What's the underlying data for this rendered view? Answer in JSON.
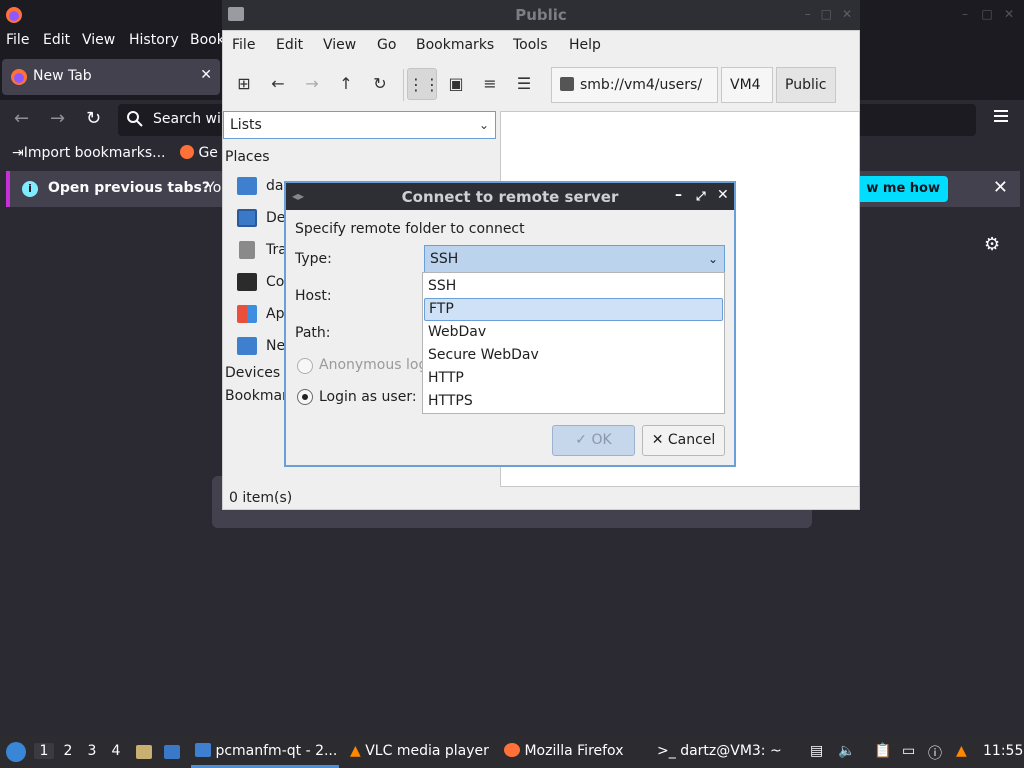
{
  "firefox": {
    "menu": [
      "File",
      "Edit",
      "View",
      "History",
      "Book"
    ],
    "tab_label": "New Tab",
    "search_placeholder": "Search wi",
    "bookmarks": {
      "import": "Import bookmarks...",
      "getting": "Ge"
    },
    "notification": {
      "title": "Open previous tabs?",
      "body": "You",
      "action": "w me how"
    },
    "colors": {
      "accent": "#00ddff",
      "notif_bar": "#c72fd9"
    }
  },
  "filemanager": {
    "title": "Public",
    "menu": [
      "File",
      "Edit",
      "View",
      "Go",
      "Bookmarks",
      "Tools",
      "Help"
    ],
    "path": [
      "smb://vm4/users/",
      "VM4",
      "Public"
    ],
    "side_combo": "Lists",
    "places_heading": "Places",
    "places": [
      "da",
      "De",
      "Tra",
      "Co",
      "Ap",
      "Ne"
    ],
    "devices": "Devices",
    "bookmarks": "Bookmar",
    "status": "0 item(s)"
  },
  "dialog": {
    "title": "Connect to remote server",
    "intro": "Specify remote folder to connect",
    "type_label": "Type:",
    "type_value": "SSH",
    "host_label": "Host:",
    "path_label": "Path:",
    "anonymous_label": "Anonymous log",
    "login_label": "Login as user:",
    "ok": "OK",
    "cancel": "Cancel",
    "options": [
      "SSH",
      "FTP",
      "WebDav",
      "Secure WebDav",
      "HTTP",
      "HTTPS"
    ],
    "highlighted_option": "FTP"
  },
  "taskbar": {
    "workspaces": [
      "1",
      "2",
      "3",
      "4"
    ],
    "tasks": [
      "pcmanfm-qt - 2...",
      "VLC media player",
      "Mozilla Firefox",
      "dartz@VM3: ~"
    ],
    "clock": "11:55"
  }
}
